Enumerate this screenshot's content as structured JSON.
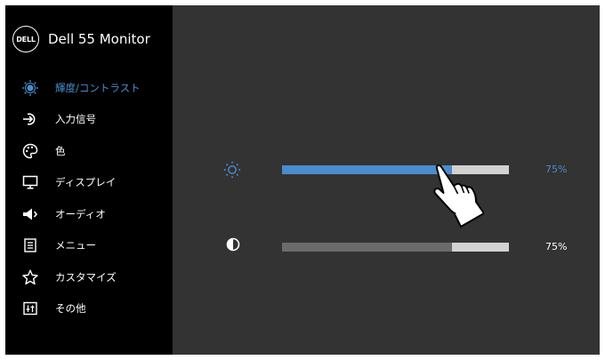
{
  "brand": {
    "logo_text": "DELL",
    "title": "Dell 55 Monitor"
  },
  "menu": {
    "items": [
      {
        "label": "輝度/コントラスト",
        "icon": "brightness-icon",
        "active": true
      },
      {
        "label": "入力信号",
        "icon": "input-source-icon",
        "active": false
      },
      {
        "label": "色",
        "icon": "color-palette-icon",
        "active": false
      },
      {
        "label": "ディスプレイ",
        "icon": "display-icon",
        "active": false
      },
      {
        "label": "オーディオ",
        "icon": "speaker-icon",
        "active": false
      },
      {
        "label": "メニュー",
        "icon": "menu-icon",
        "active": false
      },
      {
        "label": "カスタマイズ",
        "icon": "star-icon",
        "active": false
      },
      {
        "label": "その他",
        "icon": "other-icon",
        "active": false
      }
    ]
  },
  "controls": {
    "brightness": {
      "icon": "brightness-icon",
      "value": 75,
      "display": "75%"
    },
    "contrast": {
      "icon": "contrast-icon",
      "value": 75,
      "display": "75%"
    }
  },
  "colors": {
    "accent": "#4a8ccc",
    "sidebar_bg": "#000000",
    "panel_bg": "#333333",
    "track": "#d2d2d2",
    "contrast_fill": "#6b6b6b",
    "text": "#ffffff"
  },
  "pointer": {
    "icon": "hand-pointer-icon"
  }
}
